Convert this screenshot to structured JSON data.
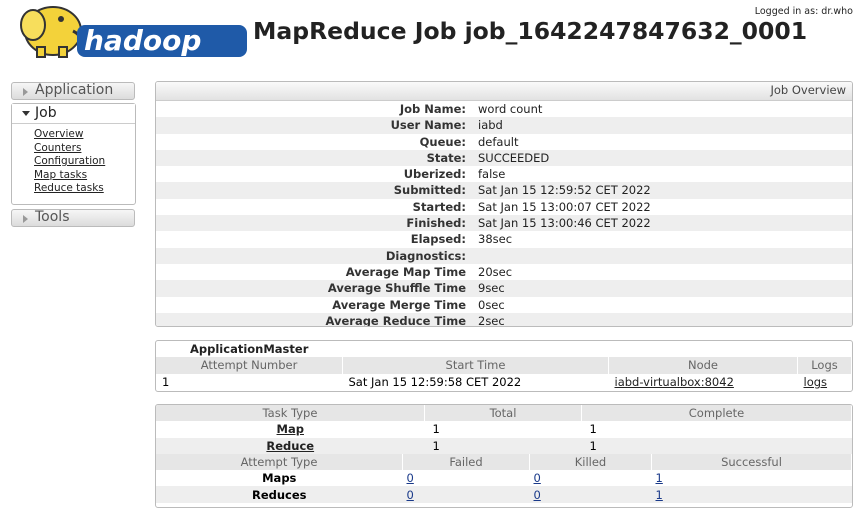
{
  "header": {
    "logo_alt": "hadoop",
    "title": "MapReduce Job job_1642247847632_0001",
    "login": "Logged in as: dr.who"
  },
  "sidebar": {
    "application": "Application",
    "job": "Job",
    "job_links": [
      "Overview",
      "Counters",
      "Configuration",
      "Map tasks",
      "Reduce tasks"
    ],
    "tools": "Tools"
  },
  "overview": {
    "header": "Job Overview",
    "rows": [
      {
        "k": "Job Name:",
        "v": "word count"
      },
      {
        "k": "User Name:",
        "v": "iabd"
      },
      {
        "k": "Queue:",
        "v": "default"
      },
      {
        "k": "State:",
        "v": "SUCCEEDED"
      },
      {
        "k": "Uberized:",
        "v": "false"
      },
      {
        "k": "Submitted:",
        "v": "Sat Jan 15 12:59:52 CET 2022"
      },
      {
        "k": "Started:",
        "v": "Sat Jan 15 13:00:07 CET 2022"
      },
      {
        "k": "Finished:",
        "v": "Sat Jan 15 13:00:46 CET 2022"
      },
      {
        "k": "Elapsed:",
        "v": "38sec"
      },
      {
        "k": "Diagnostics:",
        "v": ""
      },
      {
        "k": "Average Map Time",
        "v": "20sec"
      },
      {
        "k": "Average Shuffle Time",
        "v": "9sec"
      },
      {
        "k": "Average Merge Time",
        "v": "0sec"
      },
      {
        "k": "Average Reduce Time",
        "v": "2sec"
      }
    ]
  },
  "am": {
    "title": "ApplicationMaster",
    "cols": [
      "Attempt Number",
      "Start Time",
      "Node",
      "Logs"
    ],
    "row": {
      "attempt": "1",
      "start": "Sat Jan 15 12:59:58 CET 2022",
      "node": "iabd-virtualbox:8042",
      "logs": "logs"
    }
  },
  "tasks": {
    "cols": [
      "Task Type",
      "Total",
      "Complete"
    ],
    "rows": [
      {
        "type": "Map",
        "total": "1",
        "complete": "1"
      },
      {
        "type": "Reduce",
        "total": "1",
        "complete": "1"
      }
    ],
    "attempt_cols": [
      "Attempt Type",
      "Failed",
      "Killed",
      "Successful"
    ],
    "attempt_rows": [
      {
        "type": "Maps",
        "failed": "0",
        "killed": "0",
        "successful": "1"
      },
      {
        "type": "Reduces",
        "failed": "0",
        "killed": "0",
        "successful": "1"
      }
    ]
  }
}
